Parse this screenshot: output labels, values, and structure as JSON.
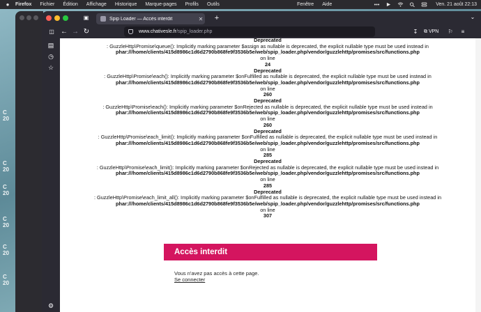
{
  "menubar": {
    "app": "Firefox",
    "items": [
      "Fichier",
      "Édition",
      "Affichage",
      "Historique",
      "Marque-pages",
      "Profils",
      "Outils"
    ],
    "right_items": [
      "Fenêtre",
      "Aide"
    ],
    "clock": "Ven. 21 août  22:13"
  },
  "wallpaper": {
    "labels": [
      "C",
      "20",
      "C",
      "20",
      "C",
      "20",
      "C",
      "20",
      "C",
      "20",
      "C",
      "20"
    ]
  },
  "browser": {
    "tab_title": "Spip Loader — Accès interdit",
    "url_host": "www.chativesle.fr",
    "url_path": "/spip_loader.php",
    "vpn_label": "VPN"
  },
  "log": {
    "header": "Deprecated",
    "entries": [
      {
        "msg": ": GuzzleHttp\\Promise\\queue(): Implicitly marking parameter $assign as nullable is deprecated, the explicit nullable type must be used instead in",
        "path": "phar:///home/clients/415d8986c1d6d2790b868fe9f3536b5e/web/spip_loader.php/vendor/guzzlehttp/promises/src/functions.php",
        "online": "on line",
        "line": "24"
      },
      {
        "msg": ": GuzzleHttp\\Promise\\each(): Implicitly marking parameter $onFulfilled as nullable is deprecated, the explicit nullable type must be used instead in",
        "path": "phar:///home/clients/415d8986c1d6d2790b868fe9f3536b5e/web/spip_loader.php/vendor/guzzlehttp/promises/src/functions.php",
        "online": "on line",
        "line": "260"
      },
      {
        "msg": ": GuzzleHttp\\Promise\\each(): Implicitly marking parameter $onRejected as nullable is deprecated, the explicit nullable type must be used instead in",
        "path": "phar:///home/clients/415d8986c1d6d2790b868fe9f3536b5e/web/spip_loader.php/vendor/guzzlehttp/promises/src/functions.php",
        "online": "on line",
        "line": "260"
      },
      {
        "msg": ": GuzzleHttp\\Promise\\each_limit(): Implicitly marking parameter $onFulfilled as nullable is deprecated, the explicit nullable type must be used instead in",
        "path": "phar:///home/clients/415d8986c1d6d2790b868fe9f3536b5e/web/spip_loader.php/vendor/guzzlehttp/promises/src/functions.php",
        "online": "on line",
        "line": "285"
      },
      {
        "msg": ": GuzzleHttp\\Promise\\each_limit(): Implicitly marking parameter $onRejected as nullable is deprecated, the explicit nullable type must be used instead in",
        "path": "phar:///home/clients/415d8986c1d6d2790b868fe9f3536b5e/web/spip_loader.php/vendor/guzzlehttp/promises/src/functions.php",
        "online": "on line",
        "line": "285"
      },
      {
        "msg": ": GuzzleHttp\\Promise\\each_limit_all(): Implicitly marking parameter $onFulfilled as nullable is deprecated, the explicit nullable type must be used instead in",
        "path": "phar:///home/clients/415d8986c1d6d2790b868fe9f3536b5e/web/spip_loader.php/vendor/guzzlehttp/promises/src/functions.php",
        "online": "on line",
        "line": "307"
      }
    ]
  },
  "error_panel": {
    "title": "Accès interdit",
    "message": "Vous n'avez pas accès à cette page.",
    "login_link": "Se connecter",
    "color": "#d4155f"
  },
  "icons": {
    "sidebar": [
      "tabs-icon",
      "history-icon",
      "bookmark-star-icon"
    ],
    "bottom": "gear-icon"
  }
}
